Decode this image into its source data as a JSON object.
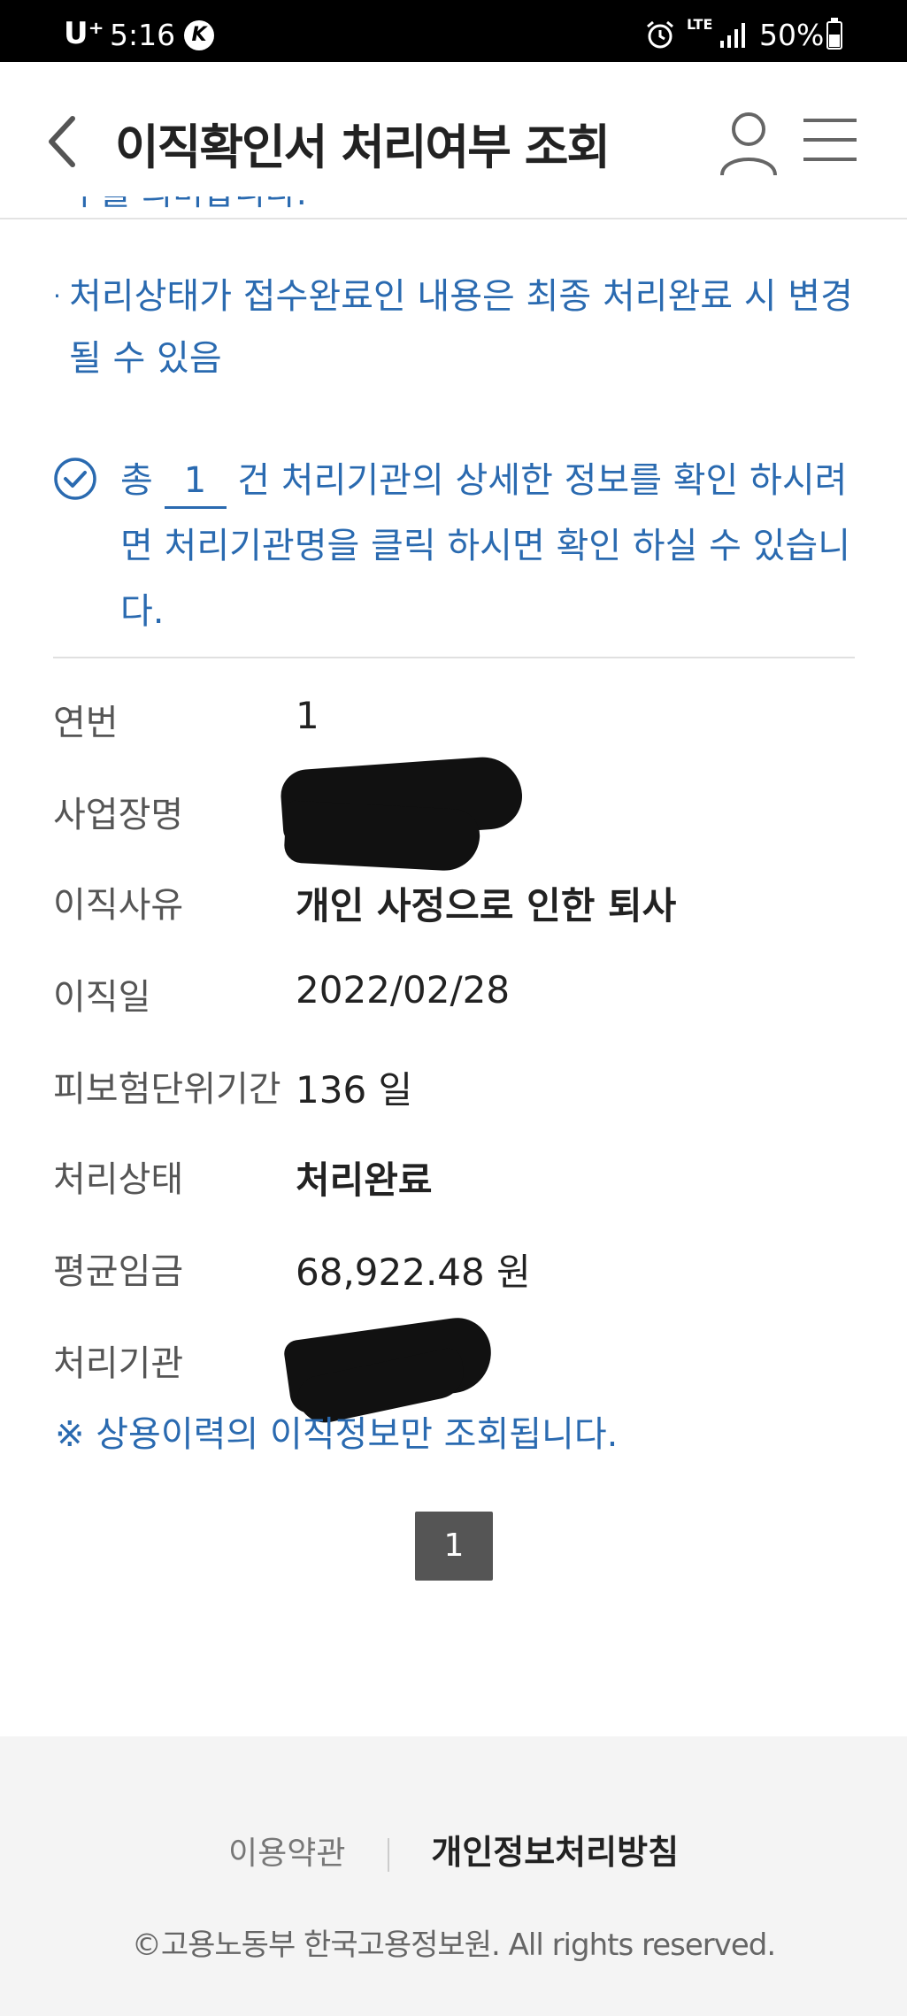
{
  "status_bar": {
    "carrier": "U⁺",
    "time": "5:16",
    "lte": "LTE",
    "battery": "50%"
  },
  "header": {
    "title": "이직확인서 처리여부 조회"
  },
  "notices": {
    "truncated_line": "수를 의미합니다.",
    "bullet": "·",
    "status_note": "처리상태가 접수완료인 내용은 최종 처리완료 시 변경될 수 있음"
  },
  "summary": {
    "prefix": "총",
    "count": "1",
    "suffix": "건 처리기관의 상세한 정보를 확인 하시려면 처리기관명을 클릭 하시면 확인 하실 수 있습니다."
  },
  "details": [
    {
      "label": "연번",
      "value": "1",
      "bold": false
    },
    {
      "label": "사업장명",
      "value": "",
      "bold": false
    },
    {
      "label": "이직사유",
      "value": "개인 사정으로 인한 퇴사",
      "bold": true
    },
    {
      "label": "이직일",
      "value": "2022/02/28",
      "bold": false
    },
    {
      "label": "피보험단위기간",
      "value": "136 일",
      "bold": false
    },
    {
      "label": "처리상태",
      "value": "처리완료",
      "bold": true
    },
    {
      "label": "평균임금",
      "value": "68,922.48 원",
      "bold": false
    },
    {
      "label": "처리기관",
      "value": "",
      "bold": false
    }
  ],
  "footnote": "※ 상용이력의 이직정보만 조회됩니다.",
  "pagination": {
    "current": "1"
  },
  "footer": {
    "terms": "이용약관",
    "privacy": "개인정보처리방침",
    "copyright": "©고용노동부 한국고용정보원. All rights reserved."
  }
}
